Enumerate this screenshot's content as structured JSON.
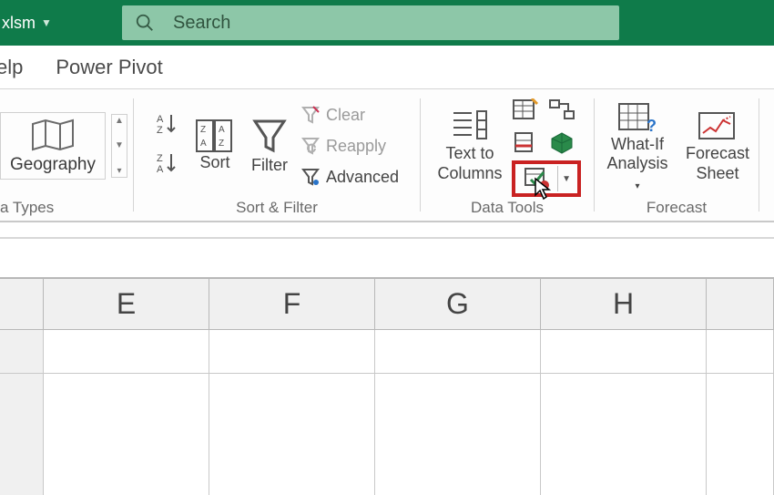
{
  "titlebar": {
    "filename_fragment": "xlsm",
    "search_placeholder": "Search"
  },
  "tabs": {
    "help_fragment": "elp",
    "power_pivot": "Power Pivot"
  },
  "ribbon": {
    "data_types": {
      "geography": "Geography",
      "group_label_fragment": "a Types"
    },
    "sort_filter": {
      "sort": "Sort",
      "filter": "Filter",
      "clear": "Clear",
      "reapply": "Reapply",
      "advanced": "Advanced",
      "group_label": "Sort & Filter"
    },
    "data_tools": {
      "text_to_columns_line1": "Text to",
      "text_to_columns_line2": "Columns",
      "group_label": "Data Tools"
    },
    "forecast": {
      "whatif_line1": "What-If",
      "whatif_line2": "Analysis",
      "forecast_sheet_line1": "Forecast",
      "forecast_sheet_line2": "Sheet",
      "group_label": "Forecast"
    }
  },
  "grid": {
    "columns": [
      "E",
      "F",
      "G",
      "H"
    ]
  }
}
